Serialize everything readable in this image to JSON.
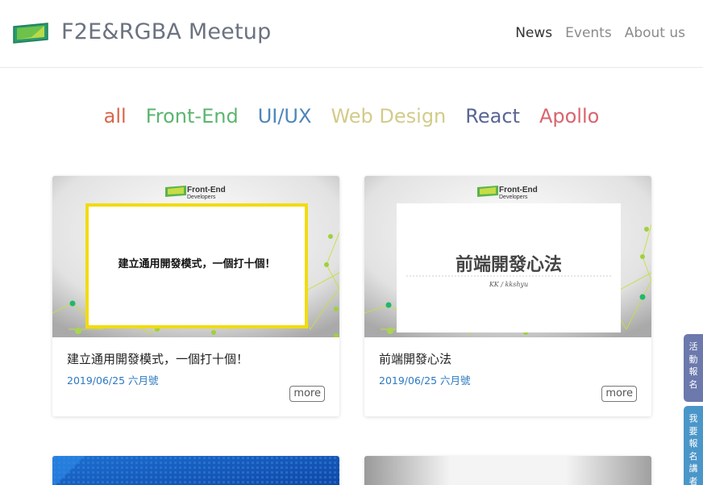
{
  "header": {
    "site_title": "F2E&RGBA Meetup",
    "nav": [
      {
        "label": "News",
        "active": true
      },
      {
        "label": "Events",
        "active": false
      },
      {
        "label": "About us",
        "active": false
      }
    ]
  },
  "categories": [
    {
      "label": "all",
      "color": "#d9664a"
    },
    {
      "label": "Front-End",
      "color": "#5bb56f"
    },
    {
      "label": "UI/UX",
      "color": "#4e86b9"
    },
    {
      "label": "Web Design",
      "color": "#d3cb8a"
    },
    {
      "label": "React",
      "color": "#5a6596"
    },
    {
      "label": "Apollo",
      "color": "#d9646e"
    }
  ],
  "cards": [
    {
      "title": "建立通用開發模式，一個打十個！",
      "date": "2019/06/25 六月號",
      "more": "more",
      "thumb": {
        "brand": "Front-End",
        "brand_sub": "Developers",
        "slide_text": "建立通用開發模式，一個打十個！"
      }
    },
    {
      "title": "前端開發心法",
      "date": "2019/06/25 六月號",
      "more": "more",
      "thumb": {
        "brand": "Front-End",
        "brand_sub": "Developers",
        "slide_text": "前端開發心法",
        "slide_sub": "KK / kkshyu"
      }
    }
  ],
  "side_tabs": [
    {
      "label": "活動報名"
    },
    {
      "label": "我要報名講者"
    }
  ]
}
